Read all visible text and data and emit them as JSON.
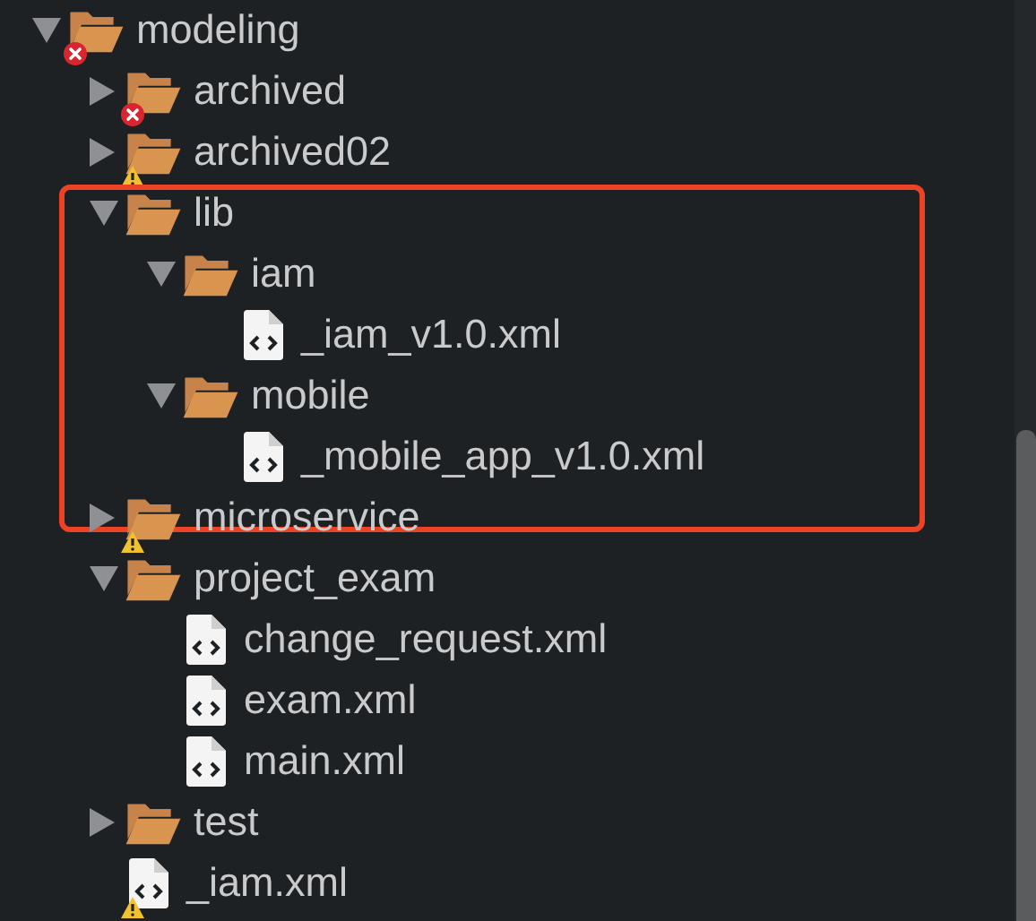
{
  "tree": [
    {
      "name": "modeling",
      "kind": "folder",
      "expanded": true,
      "error": true,
      "warning": false,
      "highlighted": false,
      "children": [
        {
          "name": "archived",
          "kind": "folder",
          "expanded": false,
          "error": true,
          "warning": false,
          "highlighted": false
        },
        {
          "name": "archived02",
          "kind": "folder",
          "expanded": false,
          "error": false,
          "warning": true,
          "highlighted": false
        },
        {
          "name": "lib",
          "kind": "folder",
          "expanded": true,
          "error": false,
          "warning": false,
          "highlighted": true,
          "children": [
            {
              "name": "iam",
              "kind": "folder",
              "expanded": true,
              "error": false,
              "warning": false,
              "highlighted": false,
              "children": [
                {
                  "name": "_iam_v1.0.xml",
                  "kind": "file",
                  "error": false,
                  "warning": false,
                  "highlighted": false
                }
              ]
            },
            {
              "name": "mobile",
              "kind": "folder",
              "expanded": true,
              "error": false,
              "warning": false,
              "highlighted": false,
              "children": [
                {
                  "name": "_mobile_app_v1.0.xml",
                  "kind": "file",
                  "error": false,
                  "warning": false,
                  "highlighted": false
                }
              ]
            }
          ]
        },
        {
          "name": "microservice",
          "kind": "folder",
          "expanded": false,
          "error": false,
          "warning": true,
          "highlighted": false
        },
        {
          "name": "project_exam",
          "kind": "folder",
          "expanded": true,
          "error": false,
          "warning": false,
          "highlighted": false,
          "children": [
            {
              "name": "change_request.xml",
              "kind": "file",
              "error": false,
              "warning": false,
              "highlighted": false
            },
            {
              "name": "exam.xml",
              "kind": "file",
              "error": false,
              "warning": false,
              "highlighted": false
            },
            {
              "name": "main.xml",
              "kind": "file",
              "error": false,
              "warning": false,
              "highlighted": false
            }
          ]
        },
        {
          "name": "test",
          "kind": "folder",
          "expanded": false,
          "error": false,
          "warning": false,
          "highlighted": false
        },
        {
          "name": "_iam.xml",
          "kind": "file",
          "error": false,
          "warning": true,
          "highlighted": false
        }
      ]
    }
  ]
}
